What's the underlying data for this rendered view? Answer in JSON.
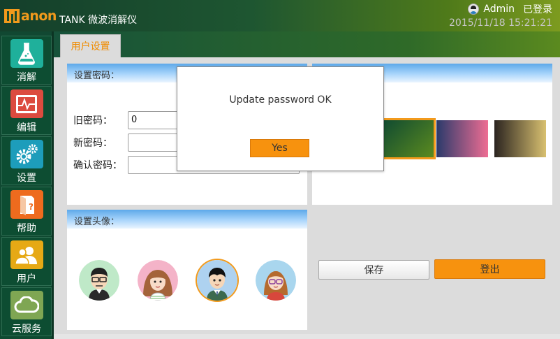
{
  "header": {
    "logo_text": "anon",
    "app_title": "TANK 微波消解仪",
    "user_name": "Admin",
    "login_status": "已登录",
    "datetime": "2015/11/18 15:21:21"
  },
  "sidebar": {
    "items": [
      {
        "label": "消解",
        "icon": "flask-icon",
        "color": "#1fb09b"
      },
      {
        "label": "编辑",
        "icon": "chart-icon",
        "color": "#dc4b3f"
      },
      {
        "label": "设置",
        "icon": "gear-icon",
        "color": "#1d9dbb"
      },
      {
        "label": "帮助",
        "icon": "help-book-icon",
        "color": "#ee6b1e"
      },
      {
        "label": "用户",
        "icon": "users-icon",
        "color": "#e6a915"
      },
      {
        "label": "云服务",
        "icon": "cloud-icon",
        "color": "#7fa653"
      }
    ],
    "active_index": 4
  },
  "tabs": [
    {
      "label": "用户设置"
    }
  ],
  "password_panel": {
    "title": "设置密码：",
    "old_label": "旧密码：",
    "old_value": "0",
    "new_label": "新密码：",
    "new_value": "",
    "confirm_label": "确认密码：",
    "confirm_value": ""
  },
  "theme_panel": {
    "swatches": [
      {
        "name": "green-theme",
        "colors": [
          "#0f4a31",
          "#5b8a1f"
        ],
        "selected": true
      },
      {
        "name": "pink-theme",
        "colors": [
          "#2a3a6b",
          "#ee6d93"
        ],
        "selected": false
      },
      {
        "name": "sepia-theme",
        "colors": [
          "#2b2420",
          "#d8c070"
        ],
        "selected": false
      }
    ]
  },
  "avatar_panel": {
    "title": "设置头像：",
    "avatars": [
      {
        "name": "avatar-glasses-man",
        "bg": "#bfe9c8",
        "selected": false
      },
      {
        "name": "avatar-girl",
        "bg": "#f4b3c8",
        "selected": false
      },
      {
        "name": "avatar-boy",
        "bg": "#aed2f0",
        "selected": true
      },
      {
        "name": "avatar-woman-glasses",
        "bg": "#a9d6ee",
        "selected": false
      }
    ]
  },
  "actions": {
    "save_label": "保存",
    "logout_label": "登出"
  },
  "dialog": {
    "message": "Update password OK",
    "button_label": "Yes"
  }
}
